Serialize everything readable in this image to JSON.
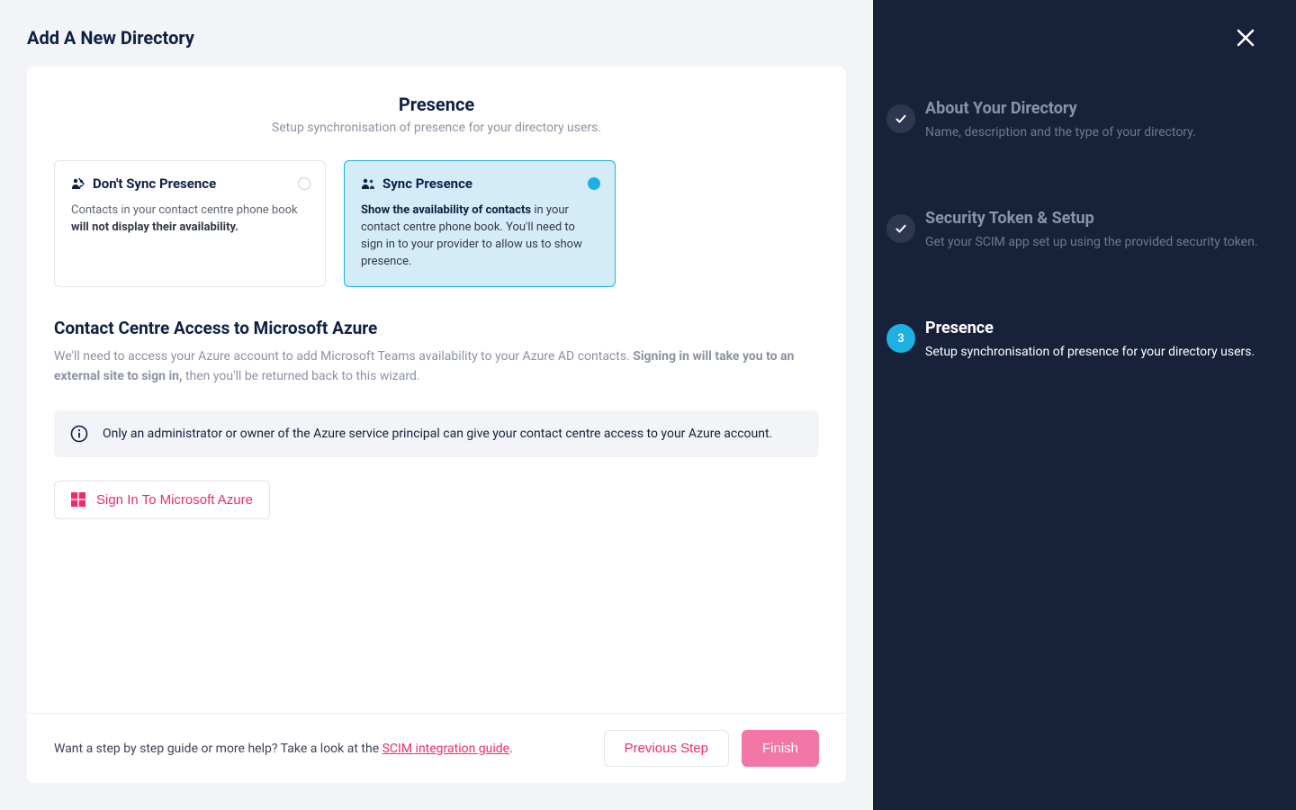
{
  "page_title": "Add A New Directory",
  "header": {
    "title": "Presence",
    "subtitle": "Setup synchronisation of presence for your directory users."
  },
  "options": {
    "dont_sync": {
      "title": "Don't Sync Presence",
      "desc_prefix": "Contacts in your contact centre phone book ",
      "desc_bold": "will not display their availability."
    },
    "sync": {
      "title": "Sync Presence",
      "desc_bold": "Show the availability of contacts",
      "desc_suffix": " in your contact centre phone book. You'll need to sign in to your provider to allow us to show presence."
    }
  },
  "azure": {
    "title": "Contact Centre Access to Microsoft Azure",
    "desc_prefix": "We'll need to access your Azure account to add Microsoft Teams availability to your Azure AD contacts. ",
    "desc_bold": "Signing in will take you to an external site to sign in,",
    "desc_suffix": " then you'll be returned back to this wizard.",
    "info": "Only an administrator or owner of the Azure service principal can give your contact centre access to your Azure account.",
    "signin_label": "Sign In To Microsoft Azure"
  },
  "footer": {
    "help_prefix": "Want a step by step guide or more help? Take a look at the ",
    "help_link": "SCIM integration guide",
    "help_suffix": ".",
    "prev_label": "Previous Step",
    "finish_label": "Finish"
  },
  "sidebar": {
    "steps": [
      {
        "title": "About Your Directory",
        "desc": "Name, description and the type of your directory."
      },
      {
        "title": "Security Token & Setup",
        "desc": "Get your SCIM app set up using the provided security token."
      },
      {
        "title": "Presence",
        "desc": "Setup synchronisation of presence for your directory users.",
        "number": "3"
      }
    ]
  }
}
